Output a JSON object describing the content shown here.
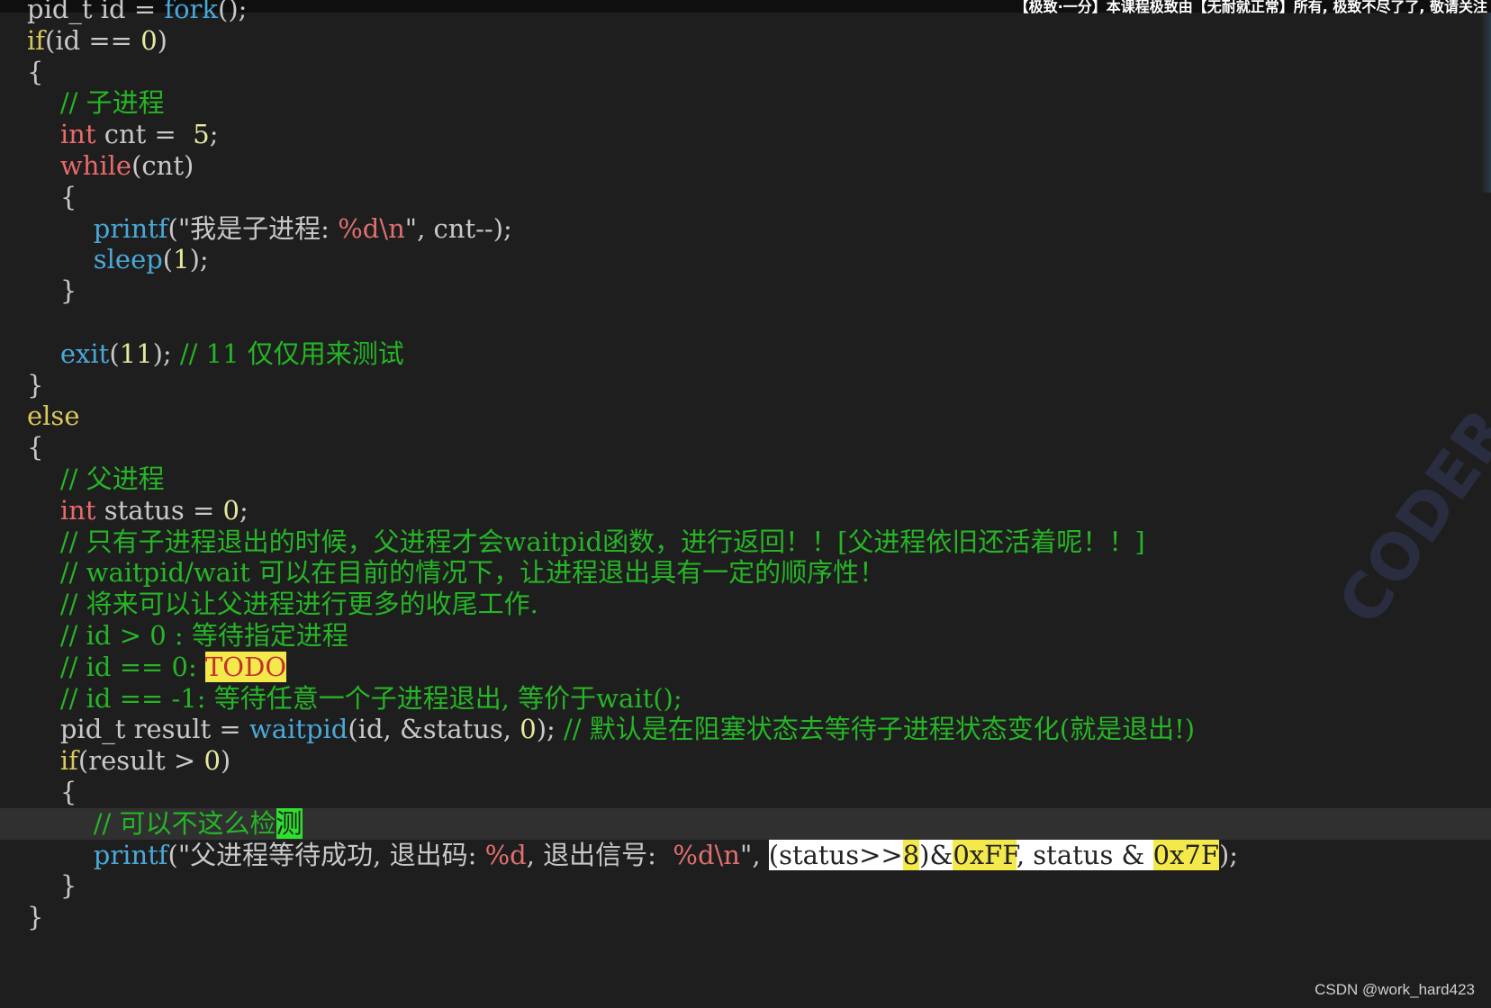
{
  "topbar": {
    "text": "【极致·一分】本课程极致由【无耐就正常】所有, 极致不尽了了, 敬请关注"
  },
  "watermark": {
    "faint_text": "CODER",
    "credit": "CSDN @work_hard423"
  },
  "code": {
    "l1": {
      "a": "pid_t id = ",
      "b": "fork",
      "c": "();"
    },
    "l2": {
      "a": "if",
      "b": "(id == ",
      "c": "0",
      "d": ")"
    },
    "l3": "{",
    "l4": "    // 子进程",
    "l5": {
      "a": "    ",
      "b": "int",
      "c": " cnt =  ",
      "d": "5",
      "e": ";"
    },
    "l6": {
      "a": "    ",
      "b": "while",
      "c": "(cnt)"
    },
    "l7": "    {",
    "l8": {
      "a": "        ",
      "b": "printf",
      "c": "(\"我是子进程: ",
      "d": "%d\\n",
      "e": "\", cnt--);"
    },
    "l9": {
      "a": "        ",
      "b": "sleep",
      "c": "(",
      "d": "1",
      "e": ");"
    },
    "l10": "    }",
    "l11": "",
    "l12": {
      "a": "    ",
      "b": "exit",
      "c": "(",
      "d": "11",
      "e": "); ",
      "f": "// 11 仅仅用来测试"
    },
    "l13": "}",
    "l14": "else",
    "l15": "{",
    "l16": "    // 父进程",
    "l17": {
      "a": "    ",
      "b": "int",
      "c": " status = ",
      "d": "0",
      "e": ";"
    },
    "l18": "    // 只有子进程退出的时候，父进程才会waitpid函数，进行返回！！[父进程依旧还活着呢！！]",
    "l19": "    // waitpid/wait 可以在目前的情况下，让进程退出具有一定的顺序性！",
    "l20": "    // 将来可以让父进程进行更多的收尾工作.",
    "l21": "    // id > 0 : 等待指定进程",
    "l22": {
      "a": "    // id == 0: ",
      "b": "TODO"
    },
    "l23": "    // id == -1: 等待任意一个子进程退出, 等价于wait();",
    "l24": {
      "a": "    pid_t result = ",
      "b": "waitpid",
      "c": "(id, &status, ",
      "d": "0",
      "e": "); ",
      "f": "// 默认是在阻塞状态去等待子进程状态变化(就是退出!)"
    },
    "l25": {
      "a": "    ",
      "b": "if",
      "c": "(result > ",
      "d": "0",
      "e": ")"
    },
    "l26": "    {",
    "l27": {
      "a": "        // 可以不这么检",
      "b": "测"
    },
    "l28": {
      "a": "        ",
      "b": "printf",
      "c": "(\"父进程等待成功, 退出码: ",
      "d": "%d",
      "e": ", 退出信号:  ",
      "f": "%d\\n",
      "g": "\", ",
      "h1": "(status>>",
      "h2": "8",
      "h3": ")&",
      "h4": "0xFF",
      "h5": ", status & ",
      "h6": "0x7F",
      "i": ");"
    },
    "l29": "    }",
    "l30": "}"
  }
}
